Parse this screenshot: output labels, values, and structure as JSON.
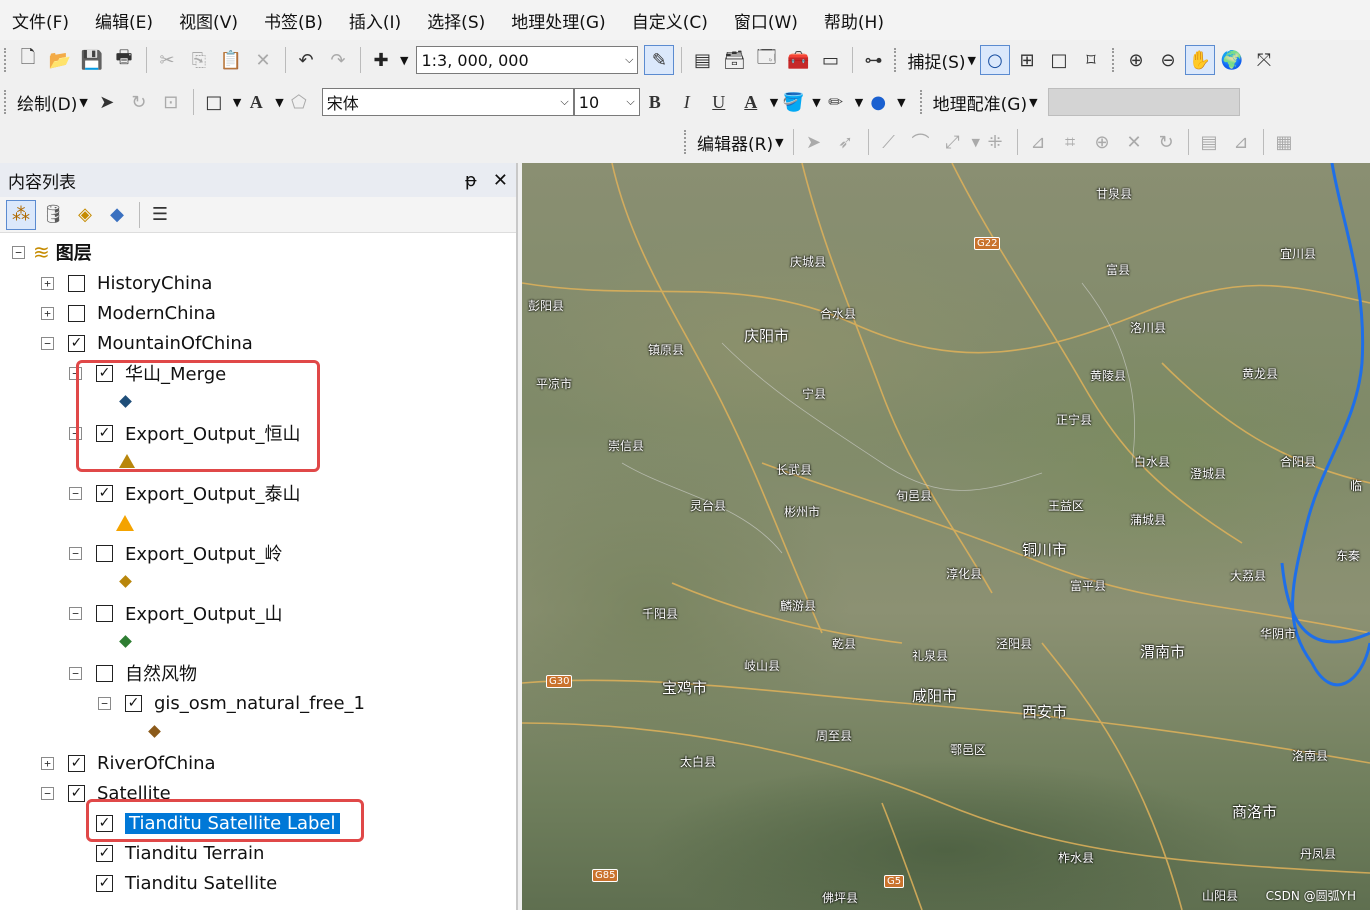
{
  "menubar": [
    "文件(F)",
    "编辑(E)",
    "视图(V)",
    "书签(B)",
    "插入(I)",
    "选择(S)",
    "地理处理(G)",
    "自定义(C)",
    "窗口(W)",
    "帮助(H)"
  ],
  "toolbar1": {
    "scale_value": "1:3, 000, 000",
    "snap_label": "捕捉(S)"
  },
  "toolbar2": {
    "draw_label": "绘制(D)",
    "font_name": "宋体",
    "font_size": "10",
    "bold": "B",
    "italic": "I",
    "underline": "U",
    "text_color_glyph": "A",
    "text_glyph": "A",
    "georef_label": "地理配准(G)"
  },
  "toolbar3": {
    "editor_label": "编辑器(R)"
  },
  "toc": {
    "title": "内容列表",
    "pin_glyph": "ᵽ",
    "close_glyph": "✕",
    "root_label": "图层",
    "layers": [
      {
        "label": "HistoryChina",
        "checked": false,
        "expander": "+"
      },
      {
        "label": "ModernChina",
        "checked": false,
        "expander": "+"
      },
      {
        "label": "MountainOfChina",
        "checked": true,
        "expander": "−"
      },
      {
        "label": "华山_Merge",
        "checked": true,
        "expander": "−"
      },
      {
        "label": "Export_Output_恒山",
        "checked": true,
        "expander": "−"
      },
      {
        "label": "Export_Output_泰山",
        "checked": true,
        "expander": "−"
      },
      {
        "label": "Export_Output_岭",
        "checked": false,
        "expander": "−"
      },
      {
        "label": "Export_Output_山",
        "checked": false,
        "expander": "−"
      },
      {
        "label": "自然风物",
        "checked": false,
        "expander": "−"
      },
      {
        "label": "gis_osm_natural_free_1",
        "checked": true,
        "expander": "−"
      },
      {
        "label": "RiverOfChina",
        "checked": true,
        "expander": "+"
      },
      {
        "label": "Satellite",
        "checked": true,
        "expander": "−"
      },
      {
        "label": "Tianditu Satellite Label",
        "checked": true,
        "selected": true
      },
      {
        "label": "Tianditu Terrain",
        "checked": true
      },
      {
        "label": "Tianditu Satellite",
        "checked": true
      }
    ],
    "symbol_colors": {
      "huashan": "#1f4e79",
      "hengshan": "#b8860b",
      "taishan": "#f4a300",
      "ling": "#b8860b",
      "shan": "#2e7d32",
      "natural": "#8b5a1a"
    }
  },
  "map": {
    "places": [
      "甘泉县",
      "宜川县",
      "庆城县",
      "富县",
      "彭阳县",
      "合水县",
      "庆阳市",
      "洛川县",
      "镇原县",
      "平凉市",
      "宁县",
      "黄陵县",
      "黄龙县",
      "崇信县",
      "正宁县",
      "白水县",
      "澄城县",
      "合阳县",
      "长武县",
      "旬邑县",
      "灵台县",
      "彬州市",
      "王益区",
      "蒲城县",
      "铜川市",
      "淳化县",
      "大荔县",
      "千阳县",
      "麟游县",
      "富平县",
      "华阴市",
      "乾县",
      "礼泉县",
      "泾阳县",
      "渭南市",
      "宝鸡市",
      "岐山县",
      "咸阳市",
      "西安市",
      "周至县",
      "鄠邑区",
      "太白县",
      "洛南县",
      "商洛市",
      "柞水县",
      "丹凤县",
      "佛坪县",
      "山阳县",
      "东秦",
      "临"
    ],
    "highways": [
      "G22",
      "G30",
      "G85",
      "G5"
    ],
    "river_color": "#1f6fe8",
    "watermark": "CSDN @圆弧YH"
  },
  "highlight_color": "#e04848",
  "selection_color": "#0078d7"
}
